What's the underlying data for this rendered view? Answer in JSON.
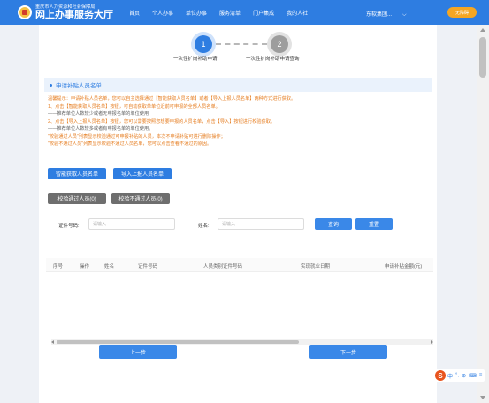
{
  "header": {
    "logo_sub": "重庆市人力资源和社会保障局",
    "logo_main": "网上办事服务大厅",
    "nav": [
      "首页",
      "个人办事",
      "单位办事",
      "服务清单",
      "门户集成",
      "我的人社"
    ],
    "company": "东软集团...",
    "logout": "无障碍"
  },
  "steps": [
    {
      "number": "1",
      "label": "一次性扩岗补助申请"
    },
    {
      "number": "2",
      "label": "一次性扩岗补助申请查询"
    }
  ],
  "section": {
    "title": "申请补贴人员名单"
  },
  "tips": [
    "温馨提示：申请补贴人员名单，您可以自主选择通过【智能获取人员名单】或者【导入上报人员名单】两种方式进行获取。",
    "1、点击【智能获取人员名单】按钮，可自动获取单单位近前可申报的全部人员名单。",
    "——推荐单位人数较少或者无申报名单的单位使用",
    "2、点击【导入上报人员名单】按钮，您可以需要按照您想要申报的人员名单，点击【导入】按钮进行校验获取。",
    "——推荐单位人数较多或者有申报名单的单位使用。",
    "\"校验通过人员\"列表显示校验通过可申报补贴的人员，本次不申请补贴可进行删除操作；",
    "\"校验不通过人员\"列表显示校验不通过人员名单，您可以点击查看不通过的原因。"
  ],
  "buttons": {
    "smart_fetch": "智能获取人员名单",
    "import_list": "导入上报人员名单",
    "passed": "校验通过人员(0)",
    "failed": "校验不通过人员(0)",
    "query": "查询",
    "reset": "重置",
    "prev": "上一步",
    "next": "下一步"
  },
  "search": {
    "id_label": "证件号码:",
    "id_placeholder": "请输入",
    "name_label": "姓名:",
    "name_placeholder": "请输入"
  },
  "table": {
    "columns": [
      "序号",
      "操作",
      "姓名",
      "证件号码",
      "人员类别证件号码",
      "实现就业日期",
      "申请补贴金额(元)"
    ]
  },
  "ime": [
    "中",
    "°,",
    "⊕",
    "⌨",
    "≡"
  ],
  "colors": {
    "primary": "#2e7de1",
    "gray_button": "#6e6e6e",
    "warning": "#e67e22",
    "logout": "#f5a623"
  }
}
